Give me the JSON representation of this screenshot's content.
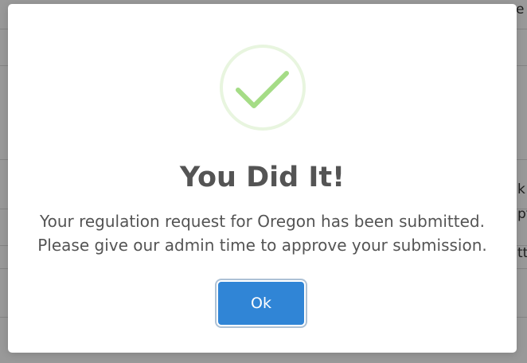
{
  "background": {
    "fragments": [
      "e F",
      "k",
      "pt",
      "tt"
    ]
  },
  "modal": {
    "icon": "success-checkmark-icon",
    "title": "You Did It!",
    "message_line1": "Your regulation request for Oregon has been submitted.",
    "message_line2": "Please give our admin time to approve your submission.",
    "ok_label": "Ok"
  },
  "colors": {
    "accent": "#3085d6",
    "success_ring": "#e8f5df",
    "success_check": "#a5dc86",
    "text": "#545454"
  }
}
